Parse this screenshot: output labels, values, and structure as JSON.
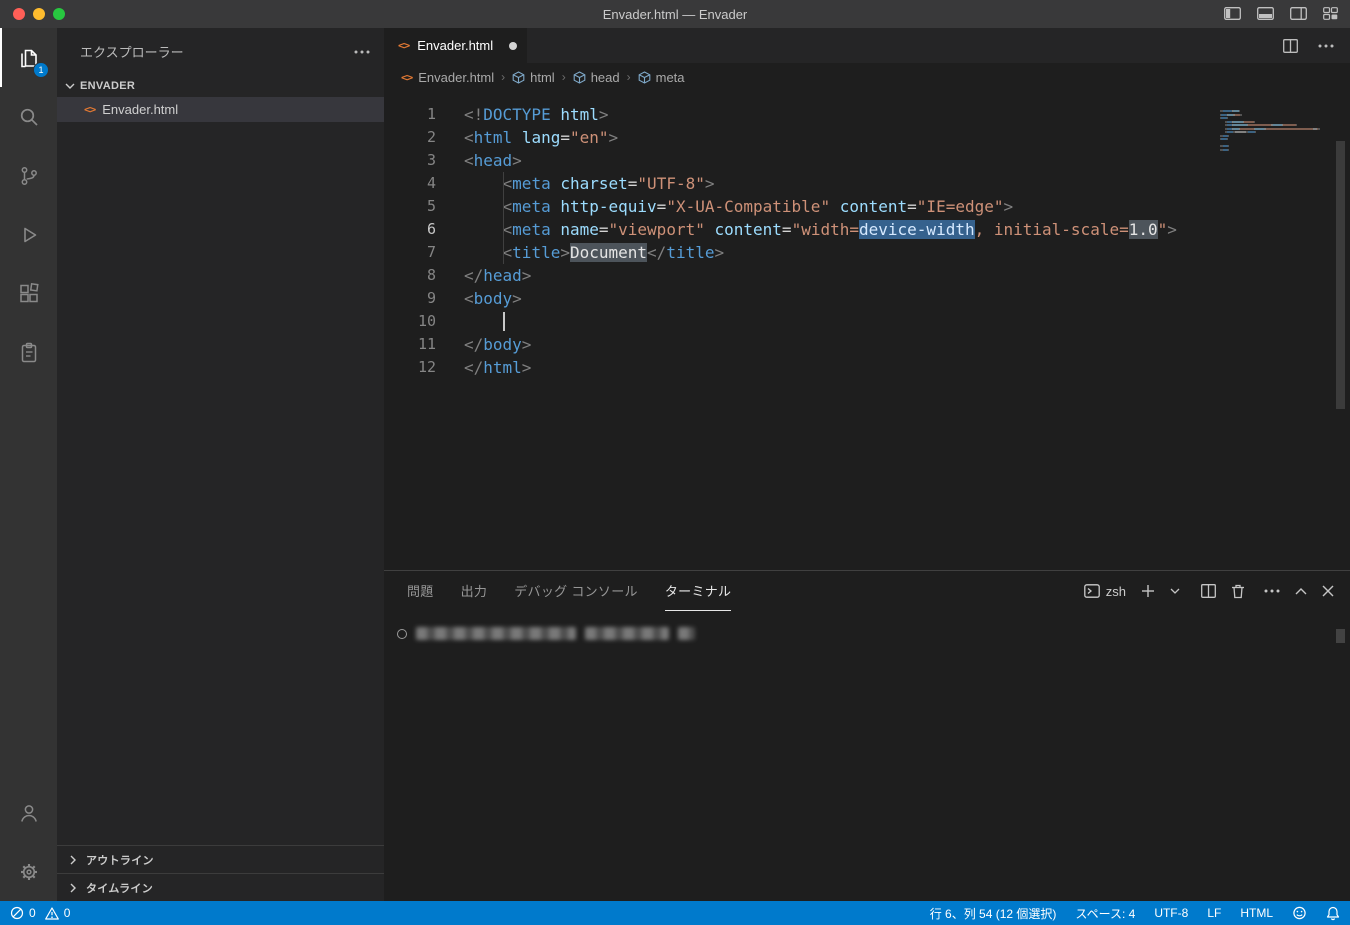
{
  "titlebar": {
    "title": "Envader.html — Envader"
  },
  "activity_bar": {
    "badge": "1"
  },
  "sidebar": {
    "title": "エクスプローラー",
    "section": "ENVADER",
    "file": {
      "name": "Envader.html"
    },
    "bottom_sections": [
      "アウトライン",
      "タイムライン"
    ]
  },
  "icons": {
    "html_file_glyph": "<>"
  },
  "editor": {
    "tab": {
      "label": "Envader.html",
      "modified": true
    },
    "breadcrumb": [
      "Envader.html",
      "html",
      "head",
      "meta"
    ],
    "code": {
      "active_line": 6,
      "lines": [
        {
          "n": 1,
          "tokens": [
            [
              "p",
              "<!"
            ],
            [
              "t",
              "DOCTYPE"
            ],
            [
              "x",
              " "
            ],
            [
              "a",
              "html"
            ],
            [
              "p",
              ">"
            ]
          ]
        },
        {
          "n": 2,
          "tokens": [
            [
              "p",
              "<"
            ],
            [
              "t",
              "html"
            ],
            [
              "x",
              " "
            ],
            [
              "a",
              "lang"
            ],
            [
              "o",
              "="
            ],
            [
              "s",
              "\"en\""
            ],
            [
              "p",
              ">"
            ]
          ]
        },
        {
          "n": 3,
          "tokens": [
            [
              "p",
              "<"
            ],
            [
              "t",
              "head"
            ],
            [
              "p",
              ">"
            ]
          ]
        },
        {
          "n": 4,
          "tokens": [
            [
              "w",
              "    "
            ],
            [
              "g",
              ""
            ],
            [
              "p",
              "<"
            ],
            [
              "t",
              "meta"
            ],
            [
              "x",
              " "
            ],
            [
              "a",
              "charset"
            ],
            [
              "o",
              "="
            ],
            [
              "s",
              "\"UTF-8\""
            ],
            [
              "p",
              ">"
            ]
          ]
        },
        {
          "n": 5,
          "tokens": [
            [
              "w",
              "    "
            ],
            [
              "g",
              ""
            ],
            [
              "p",
              "<"
            ],
            [
              "t",
              "meta"
            ],
            [
              "x",
              " "
            ],
            [
              "a",
              "http-equiv"
            ],
            [
              "o",
              "="
            ],
            [
              "s",
              "\"X-UA-Compatible\""
            ],
            [
              "x",
              " "
            ],
            [
              "a",
              "content"
            ],
            [
              "o",
              "="
            ],
            [
              "s",
              "\"IE=edge\""
            ],
            [
              "p",
              ">"
            ]
          ]
        },
        {
          "n": 6,
          "tokens": [
            [
              "w",
              "    "
            ],
            [
              "g",
              ""
            ],
            [
              "p",
              "<"
            ],
            [
              "t",
              "meta"
            ],
            [
              "x",
              " "
            ],
            [
              "a",
              "name"
            ],
            [
              "o",
              "="
            ],
            [
              "s",
              "\"viewport\""
            ],
            [
              "x",
              " "
            ],
            [
              "a",
              "content"
            ],
            [
              "o",
              "="
            ],
            [
              "s",
              "\"width="
            ],
            [
              "s sel",
              "device-width"
            ],
            [
              "s",
              ", initial-scale="
            ],
            [
              "x hl",
              "1.0"
            ],
            [
              "s",
              "\""
            ],
            [
              "p",
              ">"
            ]
          ]
        },
        {
          "n": 7,
          "tokens": [
            [
              "w",
              "    "
            ],
            [
              "g",
              ""
            ],
            [
              "p",
              "<"
            ],
            [
              "t",
              "title"
            ],
            [
              "p",
              ">"
            ],
            [
              "x hl",
              "Document"
            ],
            [
              "p",
              "</"
            ],
            [
              "t",
              "title"
            ],
            [
              "p",
              ">"
            ]
          ]
        },
        {
          "n": 8,
          "tokens": [
            [
              "p",
              "</"
            ],
            [
              "t",
              "head"
            ],
            [
              "p",
              ">"
            ]
          ]
        },
        {
          "n": 9,
          "tokens": [
            [
              "p",
              "<"
            ],
            [
              "t",
              "body"
            ],
            [
              "p",
              ">"
            ]
          ]
        },
        {
          "n": 10,
          "tokens": [
            [
              "w",
              "    "
            ],
            [
              "caret",
              ""
            ]
          ]
        },
        {
          "n": 11,
          "tokens": [
            [
              "p",
              "</"
            ],
            [
              "t",
              "body"
            ],
            [
              "p",
              ">"
            ]
          ]
        },
        {
          "n": 12,
          "tokens": [
            [
              "p",
              "</"
            ],
            [
              "t",
              "html"
            ],
            [
              "p",
              ">"
            ]
          ]
        }
      ]
    }
  },
  "panel": {
    "tabs": [
      {
        "label": "問題",
        "active": false
      },
      {
        "label": "出力",
        "active": false
      },
      {
        "label": "デバッグ コンソール",
        "active": false
      },
      {
        "label": "ターミナル",
        "active": true
      }
    ],
    "shell_label": "zsh"
  },
  "status_bar": {
    "errors": "0",
    "warnings": "0",
    "cursor_position": "行 6、列 54 (12 個選択)",
    "indentation": "スペース: 4",
    "encoding": "UTF-8",
    "eol": "LF",
    "language": "HTML"
  },
  "colors": {
    "accent": "#007acc",
    "selection": "#35618d",
    "tag": "#569cd6",
    "attribute": "#9cdcfe",
    "string": "#ce9178",
    "html_icon": "#e37933"
  }
}
